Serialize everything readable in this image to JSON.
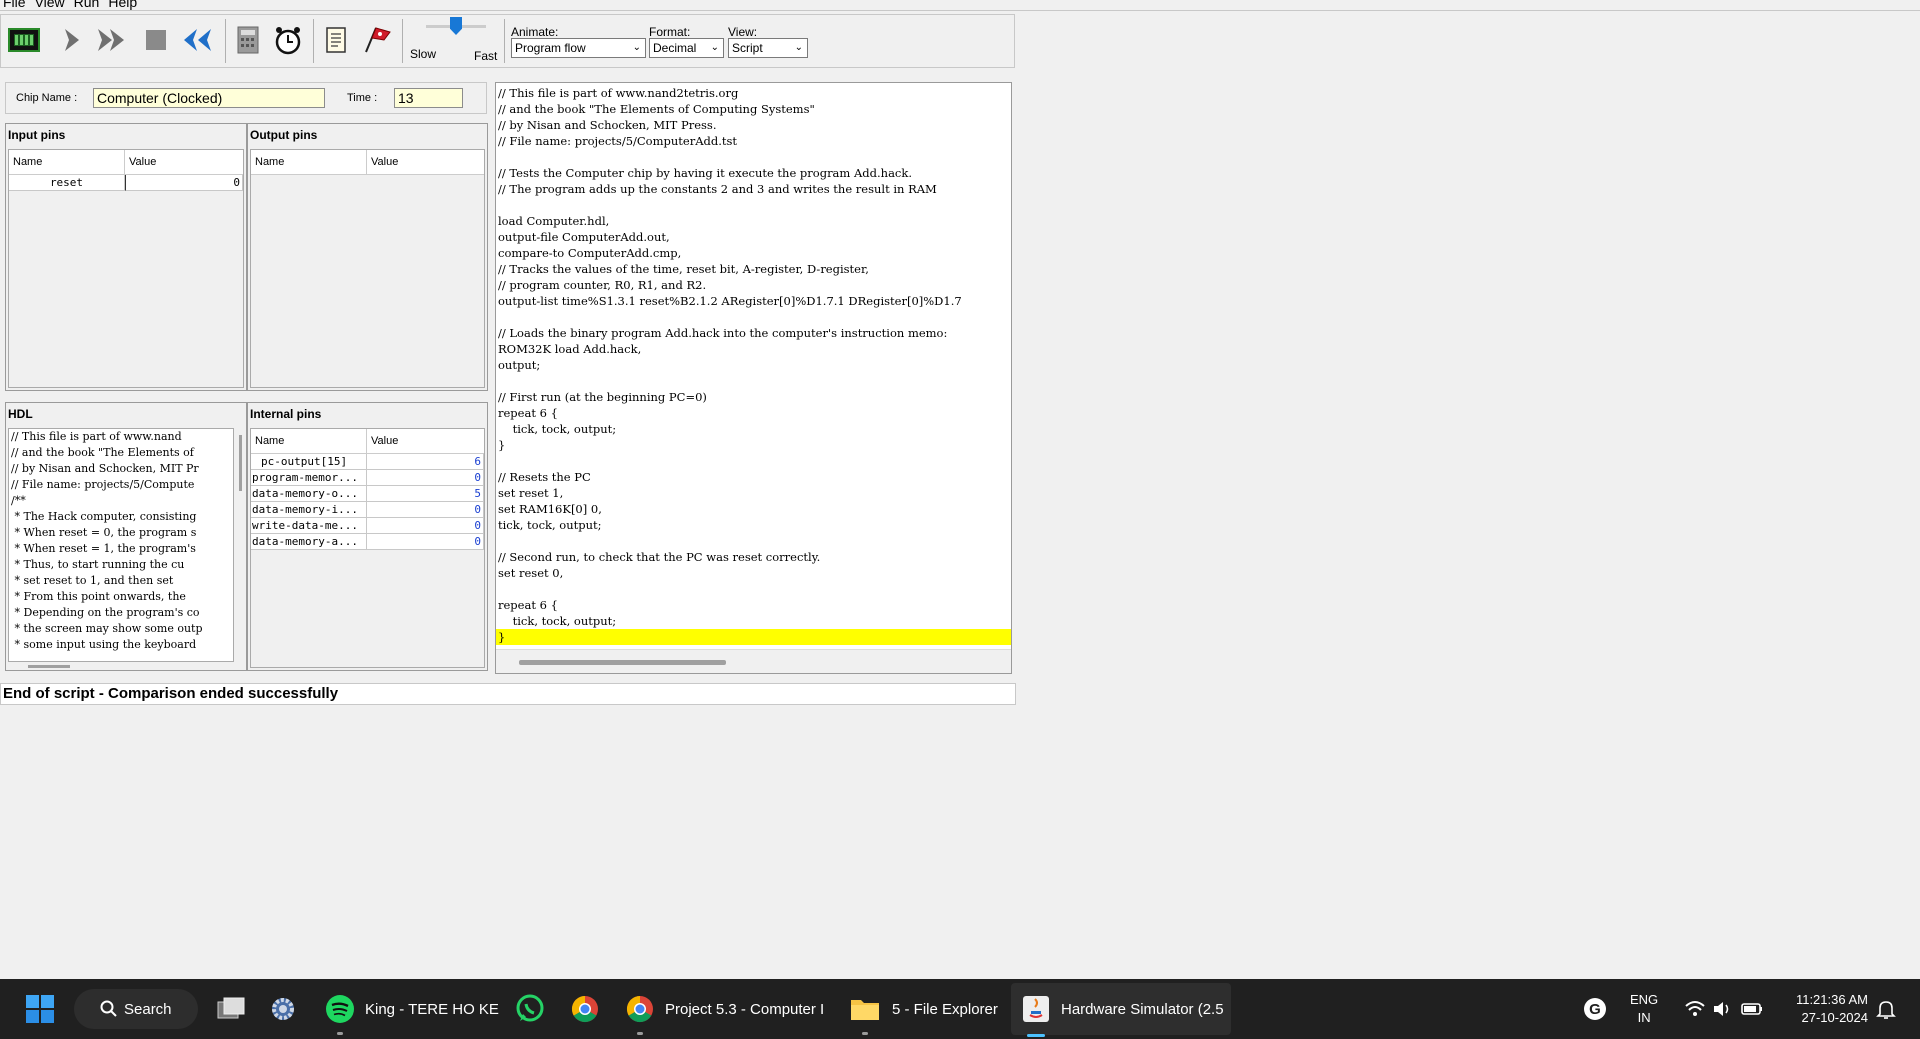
{
  "menu": [
    "File",
    "View",
    "Run",
    "Help"
  ],
  "toolbar": {
    "speed_slow": "Slow",
    "speed_fast": "Fast",
    "animate_label": "Animate:",
    "animate_value": "Program flow",
    "format_label": "Format:",
    "format_value": "Decimal",
    "view_label": "View:",
    "view_value": "Script"
  },
  "chip": {
    "name_label": "Chip Name :",
    "name_value": "Computer (Clocked)",
    "time_label": "Time :",
    "time_value": "13"
  },
  "input_pins": {
    "title": "Input pins",
    "col_name": "Name",
    "col_value": "Value",
    "rows": [
      {
        "name": "reset",
        "value": "0"
      }
    ]
  },
  "output_pins": {
    "title": "Output pins",
    "col_name": "Name",
    "col_value": "Value"
  },
  "hdl": {
    "title": "HDL",
    "lines": [
      "// This file is part of www.nand",
      "// and the book \"The Elements of",
      "// by Nisan and Schocken, MIT Pr",
      "// File name: projects/5/Compute",
      "/**",
      " * The Hack computer, consisting",
      " * When reset = 0, the program s",
      " * When reset = 1, the program's",
      " * Thus, to start running the cu",
      " * set reset to 1, and then set",
      " * From this point onwards, the",
      " * Depending on the program's co",
      " * the screen may show some outp",
      " * some input using the keyboard"
    ]
  },
  "internal_pins": {
    "title": "Internal pins",
    "col_name": "Name",
    "col_value": "Value",
    "rows": [
      {
        "name": "pc-output[15]",
        "value": "6"
      },
      {
        "name": "program-memor...",
        "value": "0"
      },
      {
        "name": "data-memory-o...",
        "value": "5"
      },
      {
        "name": "data-memory-i...",
        "value": "0"
      },
      {
        "name": "write-data-me...",
        "value": "0"
      },
      {
        "name": "data-memory-a...",
        "value": "0"
      }
    ]
  },
  "script": {
    "lines": [
      "// This file is part of www.nand2tetris.org",
      "// and the book \"The Elements of Computing Systems\"",
      "// by Nisan and Schocken, MIT Press.",
      "// File name: projects/5/ComputerAdd.tst",
      "",
      "// Tests the Computer chip by having it execute the program Add.hack.",
      "// The program adds up the constants 2 and 3 and writes the result in RAM",
      "",
      "load Computer.hdl,",
      "output-file ComputerAdd.out,",
      "compare-to ComputerAdd.cmp,",
      "// Tracks the values of the time, reset bit, A-register, D-register,",
      "// program counter, R0, R1, and R2.",
      "output-list time%S1.3.1 reset%B2.1.2 ARegister[0]%D1.7.1 DRegister[0]%D1.7",
      "",
      "// Loads the binary program Add.hack into the computer's instruction memo:",
      "ROM32K load Add.hack,",
      "output;",
      "",
      "// First run (at the beginning PC=0)",
      "repeat 6 {",
      "    tick, tock, output;",
      "}",
      "",
      "// Resets the PC",
      "set reset 1,",
      "set RAM16K[0] 0,",
      "tick, tock, output;",
      "",
      "// Second run, to check that the PC was reset correctly.",
      "set reset 0,",
      "",
      "repeat 6 {",
      "    tick, tock, output;",
      "}"
    ]
  },
  "status": "End of script - Comparison ended successfully",
  "taskbar": {
    "search": "Search",
    "spotify": "King - TERE HO KE",
    "chrome_window": "Project 5.3 - Computer I",
    "explorer": "5 - File Explorer",
    "simulator": "Hardware Simulator (2.5",
    "lang_1": "ENG",
    "lang_2": "IN",
    "time": "11:21:36 AM",
    "date": "27-10-2024"
  }
}
